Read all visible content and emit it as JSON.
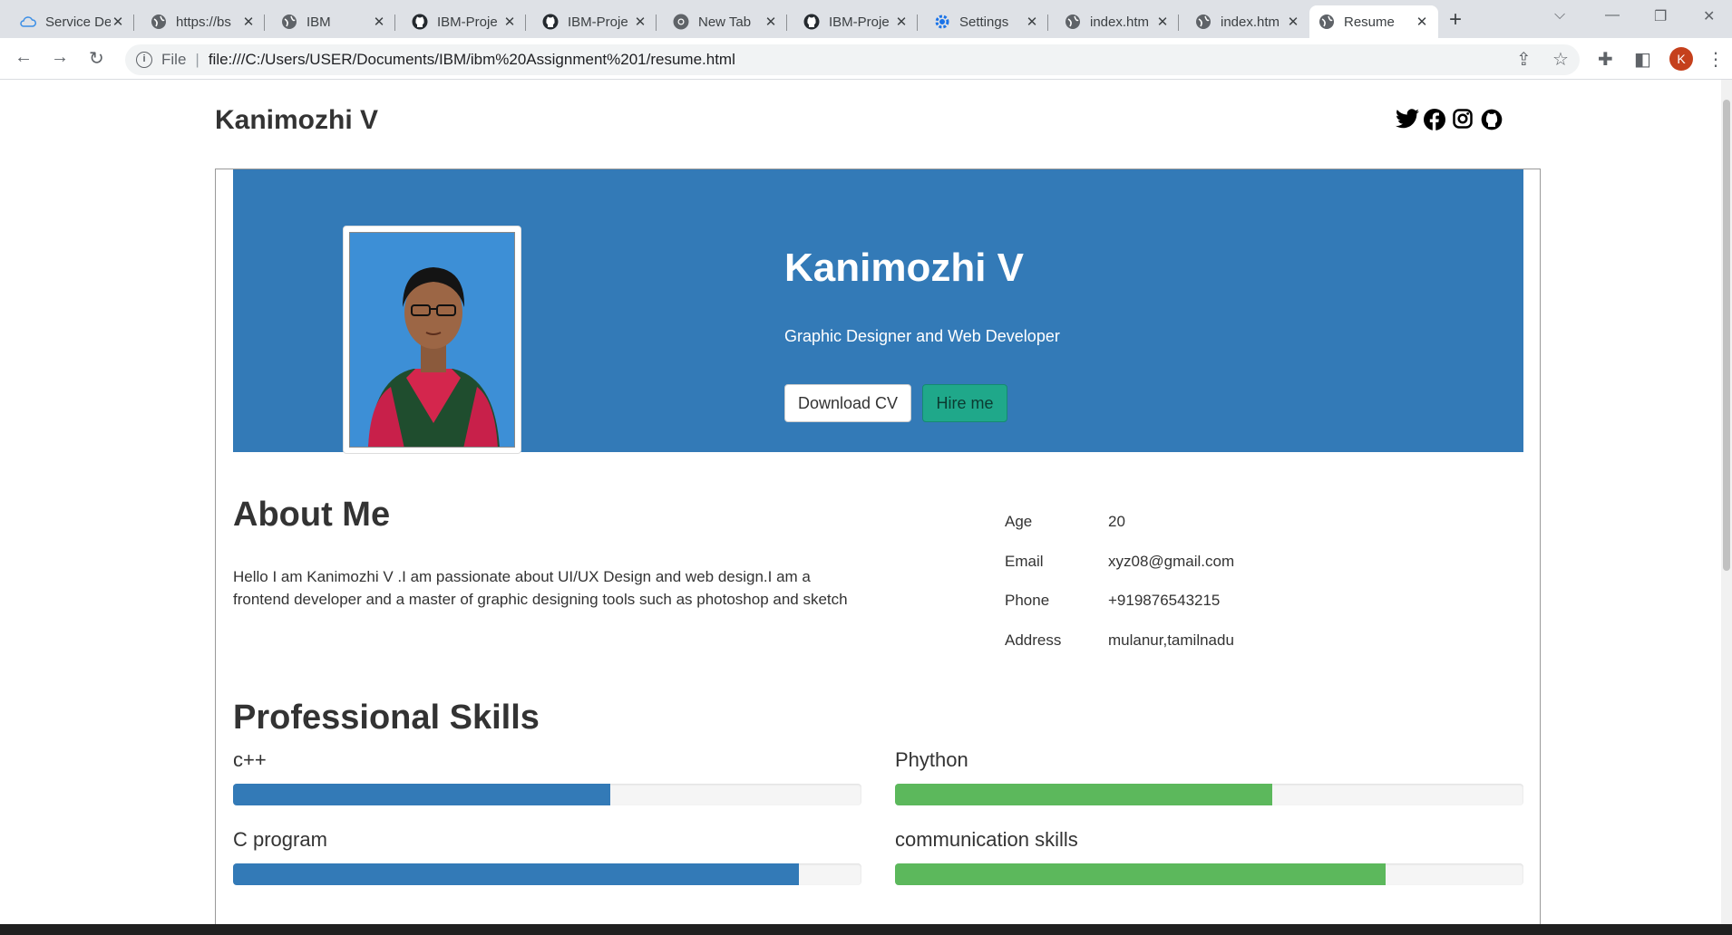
{
  "browser": {
    "tabs": [
      {
        "label": "Service Desk",
        "icon": "cloud-icon"
      },
      {
        "label": "https://bs",
        "icon": "globe-icon"
      },
      {
        "label": "IBM",
        "icon": "globe-icon"
      },
      {
        "label": "IBM-Proje",
        "icon": "github-icon"
      },
      {
        "label": "IBM-Proje",
        "icon": "github-icon"
      },
      {
        "label": "New Tab",
        "icon": "chrome-icon"
      },
      {
        "label": "IBM-Proje",
        "icon": "github-icon"
      },
      {
        "label": "Settings",
        "icon": "settings-gear-icon"
      },
      {
        "label": "index.htm",
        "icon": "globe-icon"
      },
      {
        "label": "index.htm",
        "icon": "globe-icon"
      },
      {
        "label": "Resume",
        "icon": "globe-icon"
      }
    ],
    "active_tab": 10,
    "omnibox": {
      "scheme_label": "File",
      "url": "file:///C:/Users/USER/Documents/IBM/ibm%20Assignment%201/resume.html"
    },
    "profile_initial": "K",
    "profile_color": "#c5401c"
  },
  "page": {
    "brand": "Kanimozhi V",
    "social_icons": [
      "twitter-icon",
      "facebook-icon",
      "instagram-icon",
      "github-icon"
    ],
    "hero": {
      "name": "Kanimozhi V",
      "role": "Graphic Designer and Web Developer",
      "download_label": "Download CV",
      "hire_label": "Hire me",
      "bg_color": "#337ab7"
    },
    "about": {
      "heading": "About Me",
      "text": "Hello I am Kanimozhi V .I am passionate about UI/UX Design and web design.I am a frontend developer and a master of graphic designing tools such as photoshop and sketch",
      "info": [
        {
          "key": "Age",
          "value": "20"
        },
        {
          "key": "Email",
          "value": "xyz08@gmail.com"
        },
        {
          "key": "Phone",
          "value": "+919876543215"
        },
        {
          "key": "Address",
          "value": "mulanur,tamilnadu"
        }
      ]
    },
    "skills": {
      "heading": "Professional Skills",
      "items": [
        {
          "name": "c++",
          "level": 60,
          "color": "#337ab7"
        },
        {
          "name": "Phython",
          "level": 60,
          "color": "#5cb85c"
        },
        {
          "name": "C program",
          "level": 90,
          "color": "#337ab7"
        },
        {
          "name": "communication skills",
          "level": 78,
          "color": "#5cb85c"
        }
      ]
    }
  }
}
